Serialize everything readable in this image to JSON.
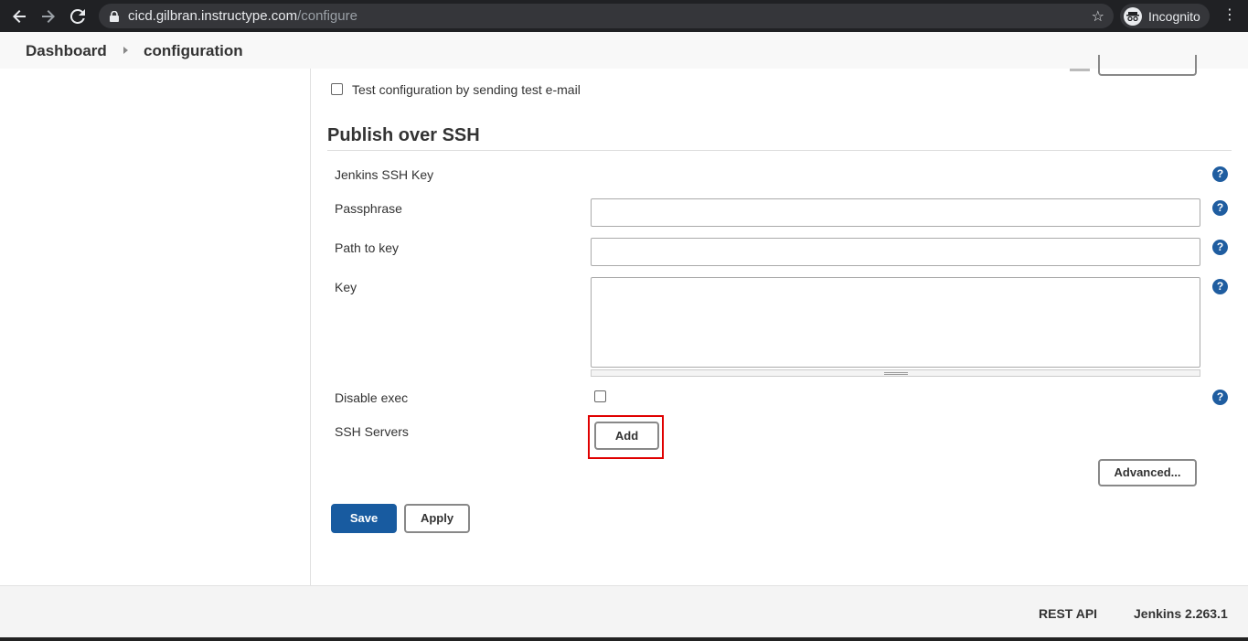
{
  "browser": {
    "url_host": "cicd.gilbran.instructype.com",
    "url_path": "/configure",
    "incognito_label": "Incognito"
  },
  "breadcrumb": {
    "items": [
      "Dashboard",
      "configuration"
    ]
  },
  "email_test": {
    "checkbox_label": "Test configuration by sending test e-mail",
    "checked": false
  },
  "publish_ssh": {
    "title": "Publish over SSH",
    "jenkins_ssh_key_label": "Jenkins SSH Key",
    "passphrase_label": "Passphrase",
    "passphrase_value": "",
    "path_to_key_label": "Path to key",
    "path_to_key_value": "",
    "key_label": "Key",
    "key_value": "",
    "disable_exec_label": "Disable exec",
    "disable_exec_checked": false,
    "ssh_servers_label": "SSH Servers",
    "add_button": "Add",
    "advanced_button": "Advanced..."
  },
  "actions": {
    "save": "Save",
    "apply": "Apply"
  },
  "footer": {
    "rest_api": "REST API",
    "version": "Jenkins 2.263.1"
  },
  "colors": {
    "primary": "#185ba0",
    "help_icon": "#1f5da0",
    "highlight": "#e00000"
  },
  "icons": {
    "help": "question-circle-icon",
    "back": "arrow-left-icon",
    "forward": "arrow-right-icon",
    "reload": "reload-icon",
    "lock": "lock-icon",
    "bookmark": "star-icon",
    "menu": "kebab-menu-icon"
  }
}
